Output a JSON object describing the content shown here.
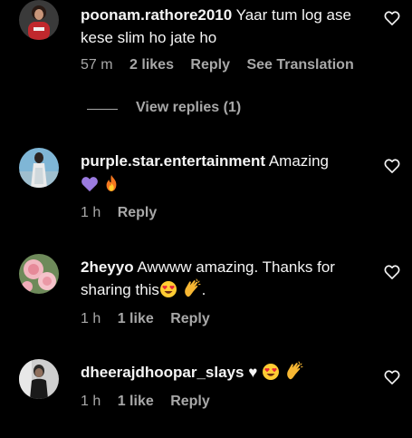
{
  "comments": [
    {
      "username": "poonam.rathore2010",
      "text": " Yaar tum log ase kese slim ho jate ho",
      "time": "57 m",
      "likes": "2 likes",
      "reply": "Reply",
      "translate": "See Translation",
      "view_replies": "View replies (1)"
    },
    {
      "username": "purple.star.entertainment",
      "text": " Amazing",
      "time": "1 h",
      "reply": "Reply",
      "emojis": [
        "purple-heart-icon",
        "fire-icon"
      ]
    },
    {
      "username": "2heyyo",
      "text": " Awwww amazing. Thanks for sharing this",
      "text_end": ".",
      "time": "1 h",
      "likes": "1 like",
      "reply": "Reply",
      "emojis": [
        "heart-eyes-icon",
        "clapping-hands-icon"
      ]
    },
    {
      "username": "dheerajdhoopar_slays",
      "text": " ♥",
      "time": "1 h",
      "likes": "1 like",
      "reply": "Reply",
      "emojis": [
        "heart-eyes-icon",
        "clapping-hands-icon"
      ]
    }
  ],
  "colors": {
    "background": "#000000",
    "text": "#f5f5f5",
    "secondary": "#a8a8a8"
  }
}
